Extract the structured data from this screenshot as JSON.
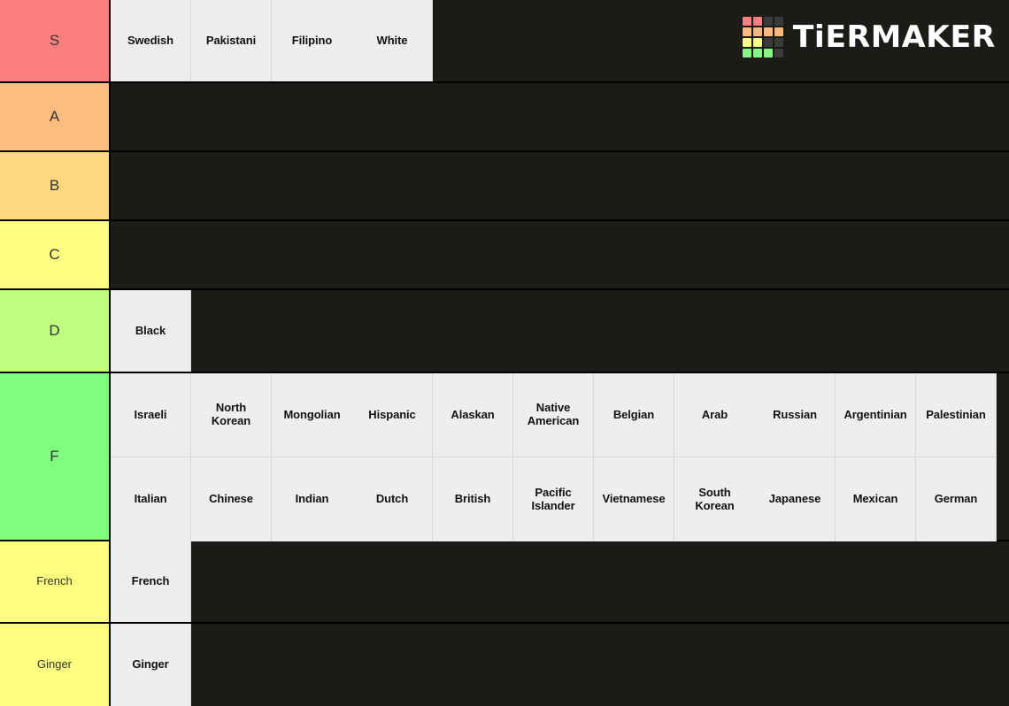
{
  "brand": {
    "name": "TiERMAKER",
    "logo_colors": [
      "#f98080",
      "#f98080",
      "#3a3a3a",
      "#3a3a3a",
      "#f9b980",
      "#f9b980",
      "#f9b980",
      "#f9b980",
      "#fbfb85",
      "#fbfb85",
      "#3a3a3a",
      "#3a3a3a",
      "#85f585",
      "#85f585",
      "#85f585",
      "#3a3a3a"
    ]
  },
  "theme": {
    "background": "#1c1b17",
    "item_background": "#eeeeee",
    "item_text": "#111111",
    "tier_text": "#333333",
    "divider": "#000000",
    "item_divider": "#d8d8d8"
  },
  "tiers": [
    {
      "label": "S",
      "color": "#fb7f7f",
      "items": [
        "Swedish",
        "Pakistani",
        "Filipino",
        "White"
      ]
    },
    {
      "label": "A",
      "color": "#fdbd7f",
      "items": []
    },
    {
      "label": "B",
      "color": "#fdd87f",
      "items": []
    },
    {
      "label": "C",
      "color": "#fdfd7f",
      "items": []
    },
    {
      "label": "D",
      "color": "#bffd7f",
      "items": [
        "Black"
      ]
    },
    {
      "label": "F",
      "color": "#7ffd7f",
      "items_row1": [
        "Israeli",
        "North Korean",
        "Mongolian",
        "Hispanic",
        "Alaskan",
        "Native American",
        "Belgian",
        "Arab",
        "Russian",
        "Argentinian",
        "Palestinian"
      ],
      "items_row2": [
        "Italian",
        "Chinese",
        "Indian",
        "Dutch",
        "British",
        "Pacific Islander",
        "Vietnamese",
        "South Korean",
        "Japanese",
        "Mexican",
        "German"
      ]
    },
    {
      "label": "French",
      "color": "#fdfd7f",
      "items": [
        "French"
      ]
    },
    {
      "label": "Ginger",
      "color": "#fdfd7f",
      "items": [
        "Ginger"
      ]
    }
  ]
}
